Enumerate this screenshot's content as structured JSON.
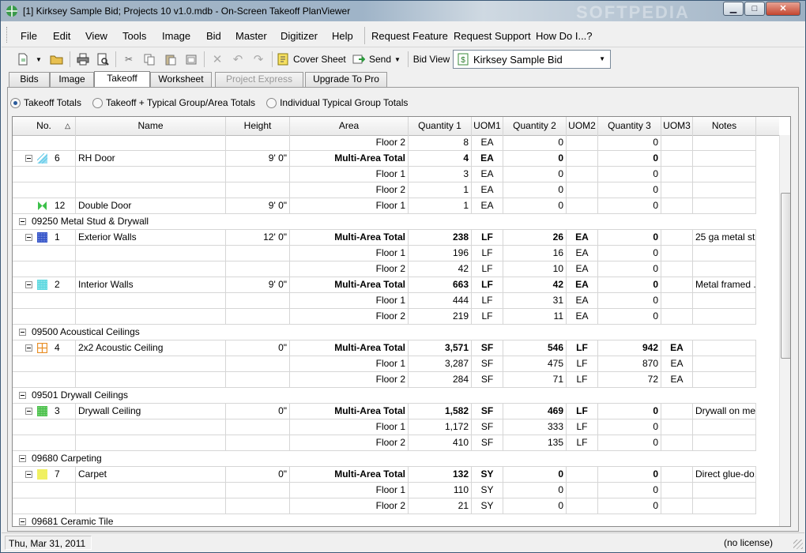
{
  "window": {
    "title": "[1] Kirksey Sample Bid; Projects 10 v1.0.mdb - On-Screen Takeoff PlanViewer",
    "watermark": "SOFTPEDIA"
  },
  "menu": {
    "items": [
      "File",
      "Edit",
      "View",
      "Tools",
      "Image",
      "Bid",
      "Master",
      "Digitizer",
      "Help"
    ],
    "extras": [
      "Request Feature",
      "Request Support",
      "How Do I...?"
    ]
  },
  "toolbar": {
    "cover_sheet": "Cover Sheet",
    "send": "Send",
    "bid_view_label": "Bid View",
    "bid_selected": "Kirksey Sample Bid"
  },
  "tabs": [
    "Bids",
    "Image",
    "Takeoff",
    "Worksheet",
    "Project Express",
    "Upgrade To Pro"
  ],
  "active_tab": "Takeoff",
  "radios": {
    "options": [
      "Takeoff Totals",
      "Takeoff + Typical Group/Area Totals",
      "Individual Typical Group Totals"
    ],
    "selected": "Takeoff Totals"
  },
  "columns": [
    "No.",
    "Name",
    "Height",
    "Area",
    "Quantity 1",
    "UOM1",
    "Quantity 2",
    "UOM2",
    "Quantity 3",
    "UOM3",
    "Notes"
  ],
  "rows": [
    {
      "t": "sub",
      "area": "Floor 2",
      "q1": "8",
      "u1": "EA",
      "q2": "0",
      "u2": "",
      "q3": "0",
      "u3": ""
    },
    {
      "t": "item",
      "no": "6",
      "name": "RH Door",
      "height": "9' 0\"",
      "area": "Multi-Area Total",
      "q1": "4",
      "u1": "EA",
      "q2": "0",
      "u2": "",
      "q3": "0",
      "u3": "",
      "notes": "",
      "color": "#5cc8e8",
      "icon": "hatch"
    },
    {
      "t": "sub",
      "area": "Floor 1",
      "q1": "3",
      "u1": "EA",
      "q2": "0",
      "u2": "",
      "q3": "0",
      "u3": ""
    },
    {
      "t": "sub",
      "area": "Floor 2",
      "q1": "1",
      "u1": "EA",
      "q2": "0",
      "u2": "",
      "q3": "0",
      "u3": ""
    },
    {
      "t": "item1",
      "no": "12",
      "name": "Double Door",
      "height": "9' 0\"",
      "area": "Floor 1",
      "q1": "1",
      "u1": "EA",
      "q2": "0",
      "u2": "",
      "q3": "0",
      "u3": "",
      "notes": "",
      "color": "#3cc04a",
      "icon": "bowtie"
    },
    {
      "t": "group",
      "label": "09250  Metal Stud & Drywall"
    },
    {
      "t": "item",
      "no": "1",
      "name": "Exterior Walls",
      "height": "12' 0\"",
      "area": "Multi-Area Total",
      "q1": "238",
      "u1": "LF",
      "q2": "26",
      "u2": "EA",
      "q3": "0",
      "u3": "",
      "notes": "25 ga metal st...",
      "color": "#3050c8",
      "icon": "dots"
    },
    {
      "t": "sub",
      "area": "Floor 1",
      "q1": "196",
      "u1": "LF",
      "q2": "16",
      "u2": "EA",
      "q3": "0",
      "u3": ""
    },
    {
      "t": "sub",
      "area": "Floor 2",
      "q1": "42",
      "u1": "LF",
      "q2": "10",
      "u2": "EA",
      "q3": "0",
      "u3": ""
    },
    {
      "t": "item",
      "no": "2",
      "name": "Interior  Walls",
      "height": "9' 0\"",
      "area": "Multi-Area Total",
      "q1": "663",
      "u1": "LF",
      "q2": "42",
      "u2": "EA",
      "q3": "0",
      "u3": "",
      "notes": "Metal framed ...",
      "color": "#5cd8e0",
      "icon": "dots"
    },
    {
      "t": "sub",
      "area": "Floor 1",
      "q1": "444",
      "u1": "LF",
      "q2": "31",
      "u2": "EA",
      "q3": "0",
      "u3": ""
    },
    {
      "t": "sub",
      "area": "Floor 2",
      "q1": "219",
      "u1": "LF",
      "q2": "11",
      "u2": "EA",
      "q3": "0",
      "u3": ""
    },
    {
      "t": "group",
      "label": "09500  Acoustical Ceilings"
    },
    {
      "t": "item",
      "no": "4",
      "name": "2x2 Acoustic Ceiling",
      "height": "0\"",
      "area": "Multi-Area Total",
      "q1": "3,571",
      "u1": "SF",
      "q2": "546",
      "u2": "LF",
      "q3": "942",
      "u3": "EA",
      "notes": "",
      "color": "#e89028",
      "icon": "grid"
    },
    {
      "t": "sub",
      "area": "Floor 1",
      "q1": "3,287",
      "u1": "SF",
      "q2": "475",
      "u2": "LF",
      "q3": "870",
      "u3": "EA"
    },
    {
      "t": "sub",
      "area": "Floor 2",
      "q1": "284",
      "u1": "SF",
      "q2": "71",
      "u2": "LF",
      "q3": "72",
      "u3": "EA"
    },
    {
      "t": "group",
      "label": "09501  Drywall Ceilings"
    },
    {
      "t": "item",
      "no": "3",
      "name": "Drywall Ceiling",
      "height": "0\"",
      "area": "Multi-Area Total",
      "q1": "1,582",
      "u1": "SF",
      "q2": "469",
      "u2": "LF",
      "q3": "0",
      "u3": "",
      "notes": "Drywall on me...",
      "color": "#48c048",
      "icon": "dots"
    },
    {
      "t": "sub",
      "area": "Floor 1",
      "q1": "1,172",
      "u1": "SF",
      "q2": "333",
      "u2": "LF",
      "q3": "0",
      "u3": ""
    },
    {
      "t": "sub",
      "area": "Floor 2",
      "q1": "410",
      "u1": "SF",
      "q2": "135",
      "u2": "LF",
      "q3": "0",
      "u3": ""
    },
    {
      "t": "group",
      "label": "09680  Carpeting"
    },
    {
      "t": "item",
      "no": "7",
      "name": "Carpet",
      "height": "0\"",
      "area": "Multi-Area Total",
      "q1": "132",
      "u1": "SY",
      "q2": "0",
      "u2": "",
      "q3": "0",
      "u3": "",
      "notes": "Direct glue-do...",
      "color": "#f0f060",
      "icon": "solid"
    },
    {
      "t": "sub",
      "area": "Floor 1",
      "q1": "110",
      "u1": "SY",
      "q2": "0",
      "u2": "",
      "q3": "0",
      "u3": ""
    },
    {
      "t": "sub",
      "area": "Floor 2",
      "q1": "21",
      "u1": "SY",
      "q2": "0",
      "u2": "",
      "q3": "0",
      "u3": ""
    },
    {
      "t": "group",
      "label": "09681  Ceramic Tile"
    }
  ],
  "status": {
    "date": "Thu, Mar 31, 2011",
    "license": "(no license)"
  }
}
